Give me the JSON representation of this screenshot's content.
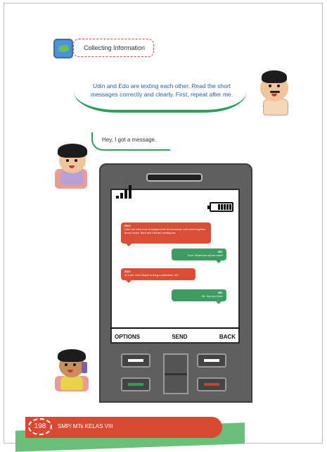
{
  "section": {
    "icon": "leaf-icon",
    "title": "Collecting Information"
  },
  "instruction": "Udin and Edo are texting each other. Read the short messages correctly and clearly. First, repeat after me.",
  "speech": "Hey, I got a message.",
  "phone": {
    "signal_icon": "signal-bars-icon",
    "battery_icon": "battery-icon",
    "messages": [
      {
        "sender": "EDO:",
        "text": "Udin, we have a lot of assignments for tomorrow. Let's work together at my house. Beni and Lina are coming too.",
        "side": "left"
      },
      {
        "sender": "ME:",
        "text": "Sure. What time will we start?",
        "side": "right"
      },
      {
        "sender": "EDO:",
        "text": "At 3 pm. Don't forget to bring a calculator, ok?",
        "side": "left"
      },
      {
        "sender": "ME:",
        "text": "Ok. See you then.",
        "side": "right"
      }
    ],
    "softkeys": {
      "options": "OPTIONS",
      "send": "SEND",
      "back": "BACK"
    }
  },
  "footer": {
    "page_number": "198",
    "book_title": "SMP/ MTs KELAS VIII"
  },
  "colors": {
    "accent_red": "#d94a33",
    "accent_green": "#3e9c63",
    "text_blue": "#2a5ea8"
  }
}
